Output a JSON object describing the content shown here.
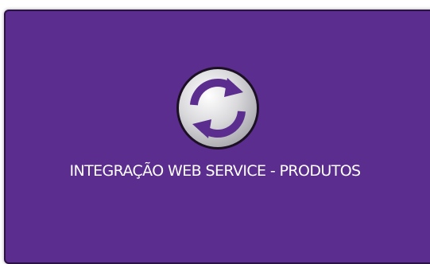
{
  "tile": {
    "title": "INTEGRAÇÃO WEB SERVICE - PRODUTOS",
    "icon": "sync-icon",
    "background_color": "#5b2d8e",
    "icon_color": "#5b2d8e"
  }
}
